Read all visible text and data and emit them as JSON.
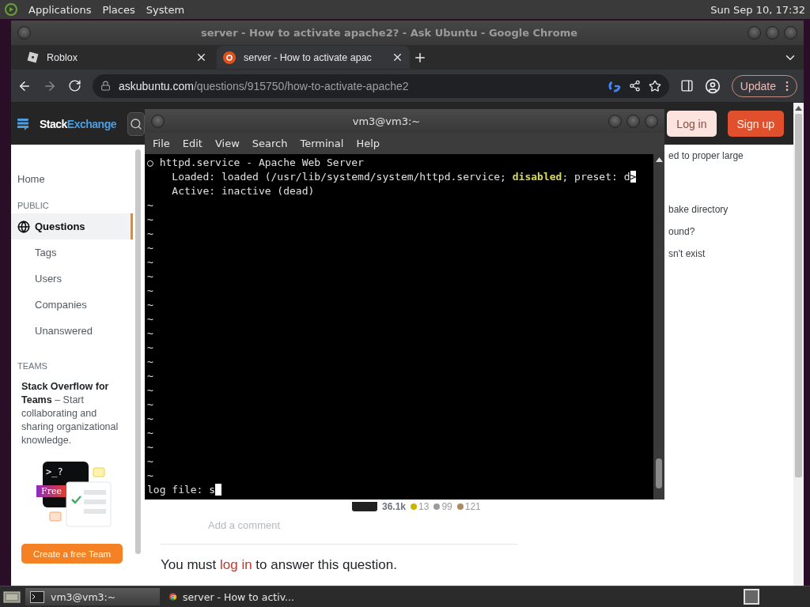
{
  "top_panel": {
    "menus": [
      "Applications",
      "Places",
      "System"
    ],
    "clock": "Sun Sep 10, 17:32"
  },
  "browser": {
    "title": "server - How to activate apache2? - Ask Ubuntu - Google Chrome",
    "tabs": [
      {
        "title": "Roblox",
        "selected": false,
        "kind": "roblox"
      },
      {
        "title": "server - How to activate apac",
        "selected": true,
        "kind": "askubuntu"
      }
    ],
    "forward_disabled": true,
    "url": {
      "host": "askubuntu.com",
      "path": "/questions/915750/how-to-activate-apache2"
    },
    "update_button": "Update"
  },
  "site_header": {
    "logo_first": "Stack",
    "logo_second": "Exchange",
    "buttons": [
      {
        "label": "Log in",
        "kind": "secondary"
      },
      {
        "label": "Sign up",
        "kind": "primary"
      }
    ]
  },
  "sidebar": {
    "home": "Home",
    "public_heading": "PUBLIC",
    "items": [
      {
        "label": "Questions",
        "selected": true
      },
      {
        "label": "Tags",
        "selected": false
      },
      {
        "label": "Users",
        "selected": false
      },
      {
        "label": "Companies",
        "selected": false
      },
      {
        "label": "Unanswered",
        "selected": false
      }
    ],
    "teams_heading": "TEAMS",
    "teams_text": "**Stack Overflow for Teams** – Start collaborating and sharing organizational knowledge.",
    "illustration_prompt": ">_?",
    "free_badge": "Free",
    "teams_button": "Create a free Team"
  },
  "related_list": [
    "ed to proper large",
    "bake directory",
    "ound?",
    "sn't exist"
  ],
  "answer_author": {
    "reputation": "36.1k",
    "badges": [
      {
        "count": "13",
        "color": "#c9b400"
      },
      {
        "count": "99",
        "color": "#9a9ca0"
      },
      {
        "count": "121",
        "color": "#ab8a5f"
      }
    ]
  },
  "add_comment": "Add a comment",
  "login_prompt": {
    "before": "You must",
    "link": "log in",
    "after": "to answer this question."
  },
  "terminal": {
    "title": "vm3@vm3:~",
    "menus": [
      "File",
      "Edit",
      "View",
      "Search",
      "Terminal",
      "Help"
    ],
    "lines": [
      {
        "text": "○ httpd.service - Apache Web Server"
      },
      {
        "text": "    Loaded: loaded (/usr/lib/systemd/system/httpd.service; **disabled**; preset: d",
        "marker": ">"
      },
      {
        "text": "    Active: inactive (dead)"
      }
    ],
    "tildes": [
      "~",
      "~",
      "~",
      "~",
      "~",
      "~",
      "~",
      "~",
      "~",
      "~",
      "~",
      "~",
      "~",
      "~",
      "~",
      "~",
      "~",
      "~",
      "~",
      "~"
    ],
    "prompt": "log file: s"
  },
  "taskbar": {
    "tasks": [
      {
        "title": "vm3@vm3:~",
        "selected": true,
        "kind": "terminal"
      },
      {
        "title": "server - How to activ...",
        "selected": false,
        "kind": "browser"
      }
    ]
  }
}
